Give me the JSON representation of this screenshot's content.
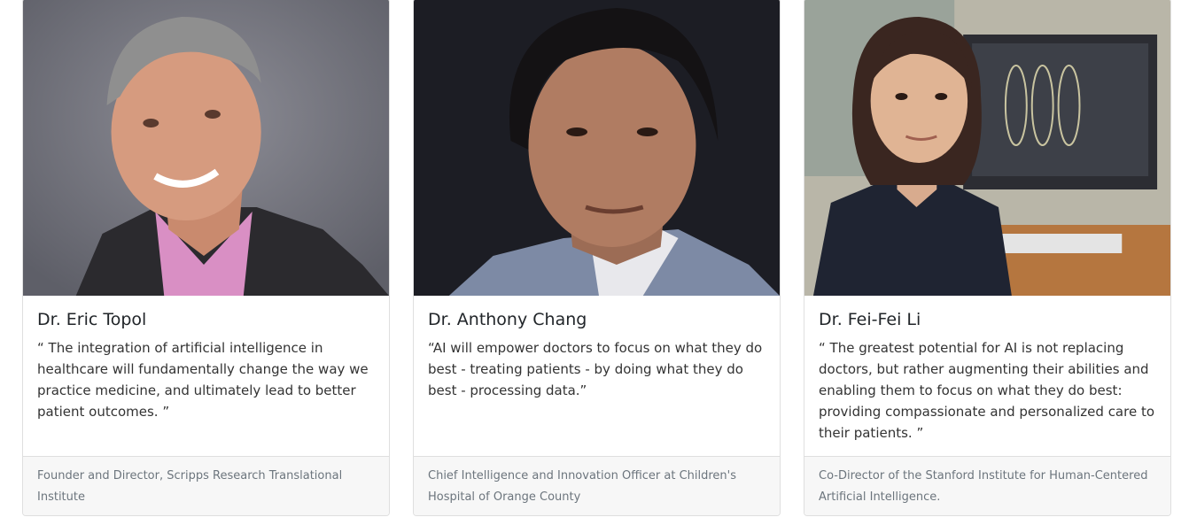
{
  "cards": [
    {
      "name": "Dr. Eric Topol",
      "quote": "“ The integration of artificial intelligence in healthcare will fundamentally change the way we practice medicine, and ultimately lead to better patient outcomes. ”",
      "title": "Founder and Director, Scripps Research Translational Institute",
      "photo": "portrait-photo"
    },
    {
      "name": "Dr. Anthony Chang",
      "quote": "“AI will empower doctors to focus on what they do best - treating patients - by doing what they do best - processing data.”",
      "title": "Chief Intelligence and Innovation Officer at Children's Hospital of Orange County",
      "photo": "portrait-photo"
    },
    {
      "name": "Dr. Fei-Fei Li",
      "quote": "“ The greatest potential for AI is not replacing doctors, but rather augmenting their abilities and enabling them to focus on what they do best: providing compassionate and personalized care to their patients. ”",
      "title": "Co-Director of the Stanford Institute for Human-Centered Artificial Intelligence.",
      "photo": "portrait-photo"
    }
  ],
  "colors": {
    "card_border": "#dfdfdf",
    "footer_bg": "#f7f7f7",
    "footer_text": "#6c757d"
  }
}
